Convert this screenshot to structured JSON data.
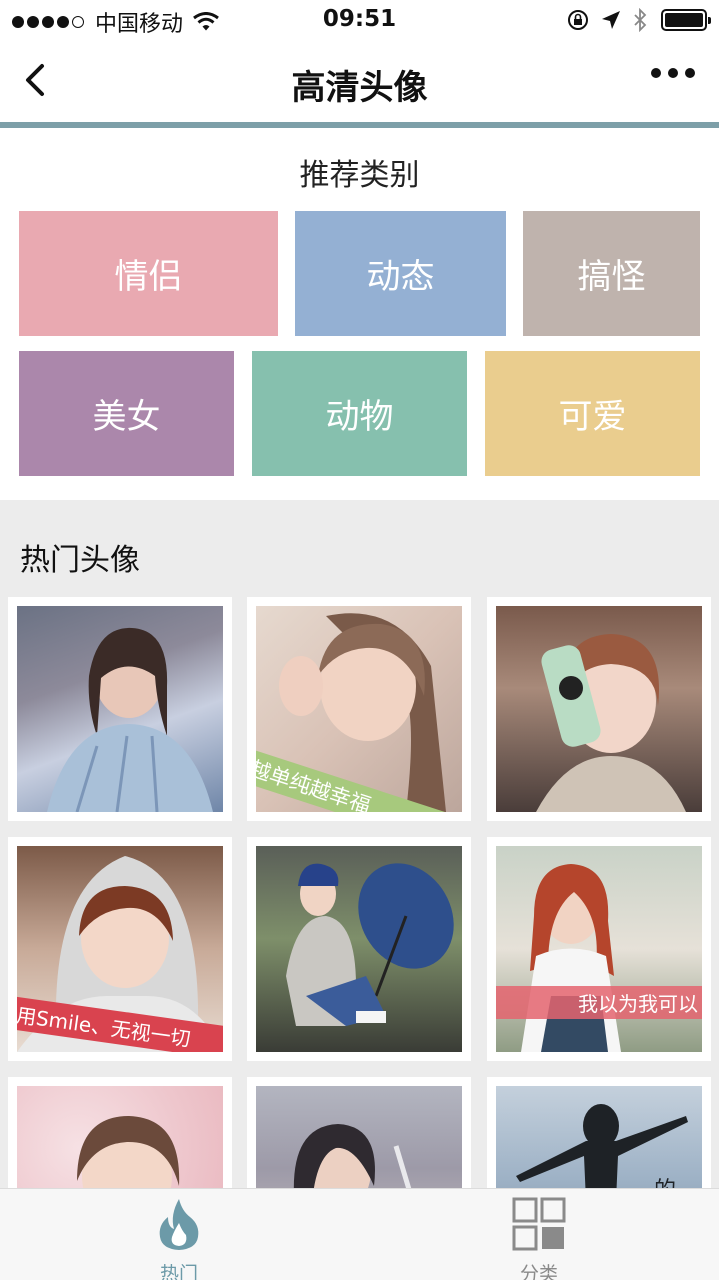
{
  "status_bar": {
    "carrier": "中国移动",
    "time": "09:51"
  },
  "nav": {
    "title": "高清头像"
  },
  "recommended": {
    "title": "推荐类别",
    "categories": [
      {
        "label": "情侣",
        "color": "#e9a9b1"
      },
      {
        "label": "动态",
        "color": "#94b0d3"
      },
      {
        "label": "搞怪",
        "color": "#bfb3ad"
      },
      {
        "label": "美女",
        "color": "#ab87ab"
      },
      {
        "label": "动物",
        "color": "#86c0ae"
      },
      {
        "label": "可爱",
        "color": "#eacd8e"
      }
    ]
  },
  "hot": {
    "title": "热门头像",
    "images": [
      {
        "banner": ""
      },
      {
        "banner": "越单纯越幸福"
      },
      {
        "banner": ""
      },
      {
        "banner": "用Smile、无视一切"
      },
      {
        "banner": ""
      },
      {
        "banner": "我以为我可以"
      },
      {
        "banner": ""
      },
      {
        "banner": ""
      },
      {
        "banner": "的"
      }
    ]
  },
  "tabs": [
    {
      "label": "热门",
      "icon": "flame-icon",
      "active": true,
      "color": "#6c9aa8"
    },
    {
      "label": "分类",
      "icon": "grid-icon",
      "active": false,
      "color": "#8a8a8a"
    }
  ],
  "colors": {
    "accent": "#7d9fa8",
    "hot_bg": "#ececec"
  }
}
